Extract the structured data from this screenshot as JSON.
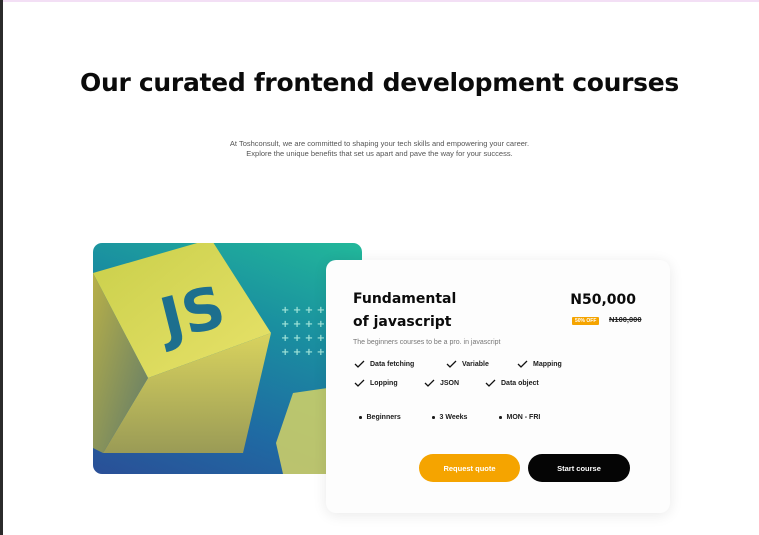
{
  "section": {
    "title": "Our curated frontend development courses",
    "subtitle_line1": "At Toshconsult, we are committed to shaping your tech skills and empowering your career.",
    "subtitle_line2": "Explore the unique benefits that set us apart and pave the way for your success."
  },
  "hero": {
    "logo_text": "JS"
  },
  "course": {
    "title_line1": "Fundamental",
    "title_line2": "of javascript",
    "price": "N50,000",
    "discount": "50% OFF",
    "old_price": "N100,000",
    "description": "The beginners courses to be a pro. in javascript",
    "features": [
      "Data fetching",
      "Variable",
      "Mapping",
      "Lopping",
      "JSON",
      "Data object"
    ],
    "meta": [
      "Beginners",
      "3 Weeks",
      "MON - FRI"
    ],
    "request_quote_label": "Request quote",
    "start_course_label": "Start course"
  },
  "colors": {
    "accent": "#f5a400",
    "dark": "#050505"
  }
}
